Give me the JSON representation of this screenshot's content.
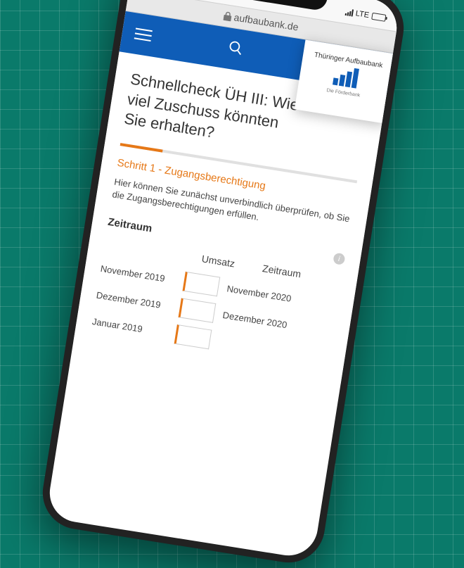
{
  "status": {
    "network": "LTE"
  },
  "url": "aufbaubank.de",
  "logo": {
    "title": "Thüringer Aufbaubank",
    "subtitle": "Die Förderbank"
  },
  "page": {
    "title": "Schnellcheck ÜH III: Wie viel Zuschuss könnten Sie erhalten?",
    "step_label": "Schritt 1 - Zugangsberechtigung",
    "description": "Hier können Sie zunächst unverbindlich überprüfen, ob Sie die Zugangsberechtigungen erfüllen.",
    "section_title": "Zeitraum",
    "col_umsatz": "Umsatz",
    "col_zeitraum": "Zeitraum",
    "rows": [
      {
        "left": "November 2019",
        "right": "November 2020"
      },
      {
        "left": "Dezember 2019",
        "right": "Dezember 2020"
      },
      {
        "left": "Januar 2019",
        "right": ""
      }
    ]
  }
}
